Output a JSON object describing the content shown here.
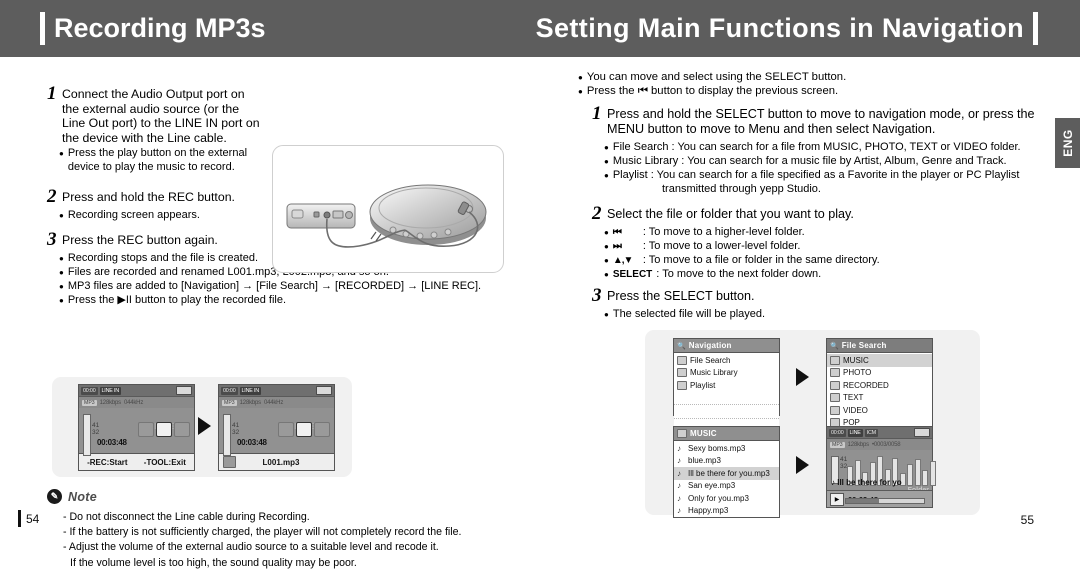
{
  "header": {
    "left_title": "Recording MP3s",
    "right_title": "Setting Main Functions in Navigation"
  },
  "side_tab": {
    "label": "ENG"
  },
  "left": {
    "step1": {
      "num": "1",
      "text": "Connect the Audio Output port on the external audio source (or the Line Out port) to the LINE IN port on the device with the Line cable.",
      "bullets": [
        "Press the play button on the external device to play the music to record."
      ]
    },
    "step2": {
      "num": "2",
      "text": "Press and hold the REC button.",
      "bullets": [
        "Recording screen appears."
      ]
    },
    "step3": {
      "num": "3",
      "text": "Press the REC button again.",
      "bullets": [
        "Recording stops and the file is created.",
        "Files are recorded and renamed L001.mp3, L002.mp3, and so on.",
        "MP3 files are added to [Navigation] → [File Search] → [RECORDED] → [LINE REC].",
        "Press the ▶II button to play the recorded file."
      ]
    },
    "lcd_a": {
      "status_time": "00:00",
      "status_mode": "LINE IN",
      "codec": "MP3",
      "bitrate": "128kbps",
      "samplerate": "044kHz",
      "volume": "41\n32",
      "volume_top": "41",
      "volume_bottom": "32",
      "time": "00:03:48",
      "watermark": "LINE IN",
      "foot_left": "-REC:Start",
      "foot_right": "-TOOL:Exit"
    },
    "lcd_b": {
      "status_time": "00:00",
      "status_mode": "LINE IN",
      "codec": "MP3",
      "bitrate": "128kbps",
      "samplerate": "044kHz",
      "volume_top": "41",
      "volume_bottom": "32",
      "time": "00:03:48",
      "watermark": "LINE IN",
      "filename": "L001.mp3"
    },
    "note": {
      "badge": "✎",
      "title": "Note",
      "items": [
        "- Do not disconnect the Line cable during Recording.",
        "- If the battery is not sufficiently charged, the player will not completely record the file.",
        "- Adjust the volume of the external audio source to a suitable level and recode it.",
        "If the volume level is too high, the sound quality may be poor."
      ]
    },
    "page_number": "54"
  },
  "right": {
    "intro_bullets": [
      "You can move and select using the SELECT button.",
      "Press the ⏮ button to display the previous screen."
    ],
    "step1": {
      "num": "1",
      "text": "Press and hold the SELECT button to move to navigation mode, or press the MENU button to move to Menu and then select Navigation.",
      "bullets": [
        "File Search : You can search for a file from MUSIC, PHOTO, TEXT or VIDEO folder.",
        "Music Library : You can search for a music file by Artist, Album, Genre and Track.",
        "Playlist : You can search for a file specified as a Favorite in the player or PC Playlist"
      ],
      "bullet_cont": "transmitted through yepp Studio."
    },
    "step2": {
      "num": "2",
      "text": "Select the file or folder that you want to play.",
      "bullets": [
        {
          "glyph": "⏮",
          "text": ": To move to a higher-level folder."
        },
        {
          "glyph": "⏭",
          "text": ": To move to a lower-level folder."
        },
        {
          "glyph": "▲,▼",
          "text": ": To move to a file or folder in the same directory."
        },
        {
          "glyph": "SELECT",
          "text": ": To move to the next folder down."
        }
      ]
    },
    "step3": {
      "num": "3",
      "text": "Press the SELECT button.",
      "bullets": [
        "The selected file will be played."
      ]
    },
    "screens": {
      "navigation": {
        "title": "Navigation",
        "items": [
          "File Search",
          "Music Library",
          "Playlist"
        ]
      },
      "file_search": {
        "title": "File Search",
        "items": [
          "MUSIC",
          "PHOTO",
          "RECORDED",
          "TEXT",
          "VIDEO",
          "POP"
        ],
        "selected": "MUSIC"
      },
      "music": {
        "title": "MUSIC",
        "items": [
          "Sexy boms.mp3",
          "blue.mp3",
          "Ill be there for you.mp3",
          "San eye.mp3",
          "Only for you.mp3",
          "Happy.mp3"
        ],
        "selected": "Ill be there for you.mp3"
      },
      "player": {
        "status_time": "00:00",
        "status_mode": "LINE",
        "status_extra": "ICM",
        "codec": "MP3",
        "bitrate": "128kbps",
        "track_pos": "•0003/0058",
        "volume_top": "41",
        "volume_bottom": "32",
        "title": "Ill be there for yo",
        "folder_tag": "Folder",
        "time": "00:03:48"
      }
    },
    "page_number": "55"
  }
}
